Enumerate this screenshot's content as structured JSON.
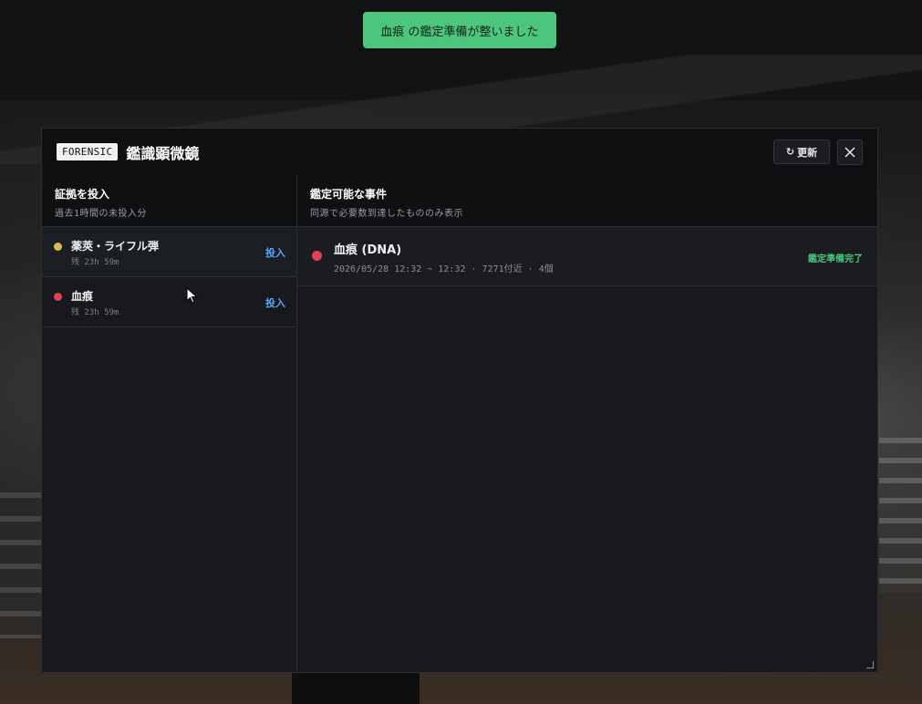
{
  "toast": {
    "message": "血痕 の鑑定準備が整いました",
    "color": "#4cc57d"
  },
  "header": {
    "tag": "FORENSIC",
    "title": "鑑識顕微鏡",
    "refresh_label": "更新",
    "refresh_icon": "refresh-icon",
    "close_icon": "close-icon"
  },
  "evidence_panel": {
    "title": "証拠を投入",
    "subtitle": "過去1時間の未投入分",
    "items": [
      {
        "name": "薬莢・ライフル弾",
        "remaining": "残 23h 59m",
        "action": "投入",
        "dot_color": "#e0b84c"
      },
      {
        "name": "血痕",
        "remaining": "残 23h 59m",
        "action": "投入",
        "dot_color": "#e0434f"
      }
    ]
  },
  "cases_panel": {
    "title": "鑑定可能な事件",
    "subtitle": "同源で必要数到達したもののみ表示",
    "cases": [
      {
        "title": "血痕 (DNA)",
        "meta": "2026/05/28 12:32 ~ 12:32 · 7271付近 · 4個",
        "status": "鑑定準備完了",
        "dot_color": "#e0434f"
      }
    ]
  },
  "colors": {
    "accent_green": "#4cc57d",
    "link_blue": "#5aa0ff",
    "panel_bg": "#16181b"
  }
}
